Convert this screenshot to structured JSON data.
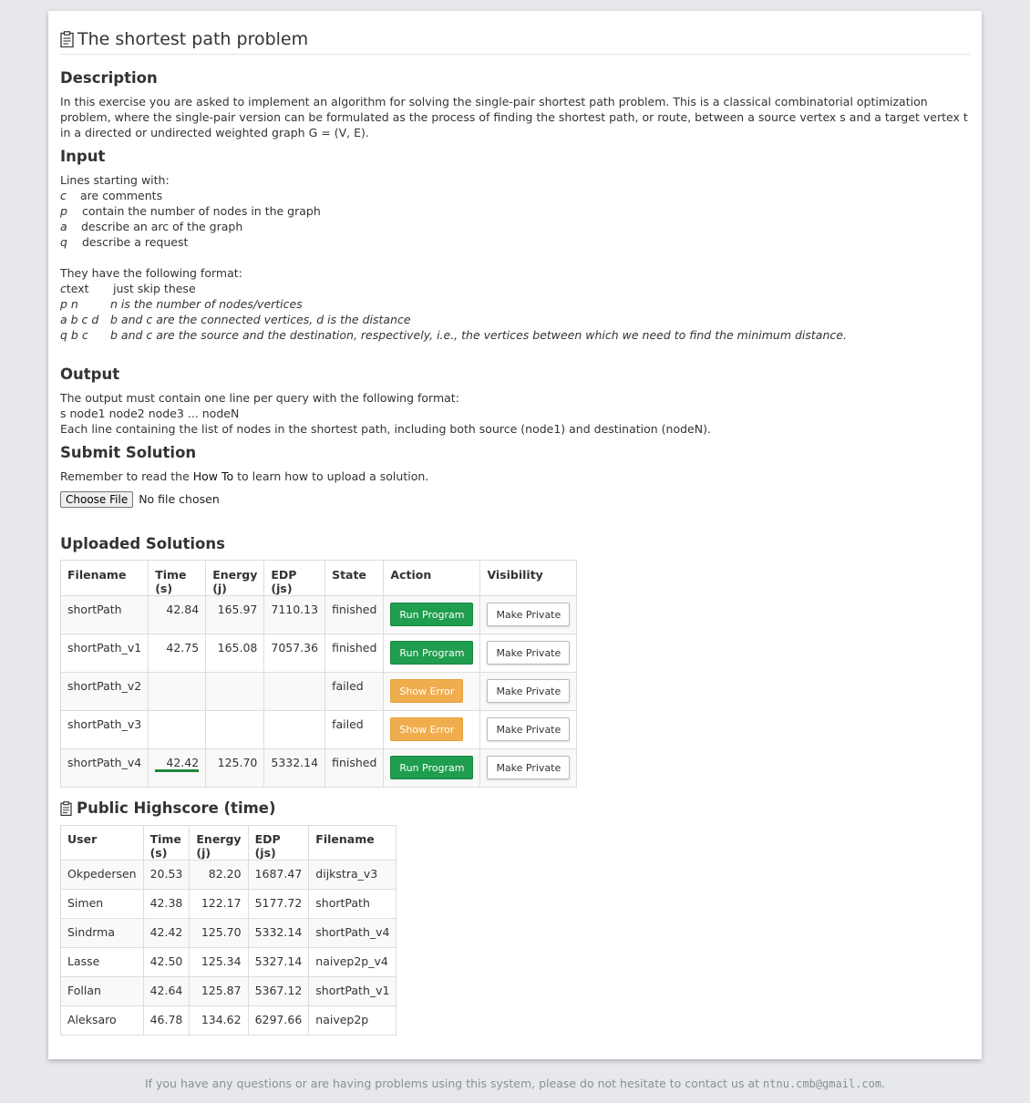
{
  "title": "The shortest path problem",
  "description": {
    "heading": "Description",
    "text": "In this exercise you are asked to implement an algorithm for solving the single-pair shortest path problem. This is a classical combinatorial optimization problem, where the single-pair version can be formulated as the process of finding the shortest path, or route, between a source vertex s and a target vertex t in a directed or undirected weighted graph G = (V, E)."
  },
  "input": {
    "heading": "Input",
    "intro": "Lines starting with:",
    "lines": [
      {
        "key": "c",
        "text": "are comments"
      },
      {
        "key": "p",
        "text": "contain the number of nodes in the graph"
      },
      {
        "key": "a",
        "text": "describe an arc of the graph"
      },
      {
        "key": "q",
        "text": "describe a request"
      }
    ],
    "format_intro": "They have the following format:",
    "formats": [
      {
        "key": "c",
        "key_rest": "text",
        "text": "just skip these"
      },
      {
        "key": "p n",
        "key_rest": "",
        "text": "n is the number of nodes/vertices"
      },
      {
        "key": "a b c d",
        "key_rest": "",
        "text": "b and c are the connected vertices, d is the distance"
      },
      {
        "key": "q b c",
        "key_rest": "",
        "text": "b and c are the source and the destination, respectively, i.e., the vertices between which we need to find the minimum distance."
      }
    ]
  },
  "output": {
    "heading": "Output",
    "line1": "The output must contain one line per query with the following format:",
    "line2": "s node1 node2 node3 ... nodeN",
    "line3": "Each line containing the list of nodes in the shortest path, including both source (node1) and destination (nodeN)."
  },
  "submit": {
    "heading": "Submit Solution",
    "text_before": "Remember to read the",
    "link": "How To",
    "text_after": "to learn how to upload a solution.",
    "file_button": "Choose File",
    "file_status": "No file chosen"
  },
  "uploaded": {
    "heading": "Uploaded Solutions",
    "columns": [
      "Filename",
      "Time (s)",
      "Energy (j)",
      "EDP (js)",
      "State",
      "Action",
      "Visibility"
    ],
    "rows": [
      {
        "filename": "shortPath",
        "time": "42.84",
        "energy": "165.97",
        "edp": "7110.13",
        "state": "finished",
        "action": "Run Program",
        "action_kind": "green",
        "visibility": "Make Private"
      },
      {
        "filename": "shortPath_v1",
        "time": "42.75",
        "energy": "165.08",
        "edp": "7057.36",
        "state": "finished",
        "action": "Run Program",
        "action_kind": "green",
        "visibility": "Make Private"
      },
      {
        "filename": "shortPath_v2",
        "time": "",
        "energy": "",
        "edp": "",
        "state": "failed",
        "action": "Show Error",
        "action_kind": "orange",
        "visibility": "Make Private"
      },
      {
        "filename": "shortPath_v3",
        "time": "",
        "energy": "",
        "edp": "",
        "state": "failed",
        "action": "Show Error",
        "action_kind": "orange",
        "visibility": "Make Private"
      },
      {
        "filename": "shortPath_v4",
        "time": "42.42",
        "energy": "125.70",
        "edp": "5332.14",
        "state": "finished",
        "action": "Run Program",
        "action_kind": "green",
        "visibility": "Make Private"
      }
    ]
  },
  "highscore": {
    "heading": "Public Highscore (time)",
    "columns": [
      "User",
      "Time (s)",
      "Energy (j)",
      "EDP (js)",
      "Filename"
    ],
    "rows": [
      {
        "user": "Okpedersen",
        "time": "20.53",
        "energy": "82.20",
        "edp": "1687.47",
        "filename": "dijkstra_v3"
      },
      {
        "user": "Simen",
        "time": "42.38",
        "energy": "122.17",
        "edp": "5177.72",
        "filename": "shortPath"
      },
      {
        "user": "Sindrma",
        "time": "42.42",
        "energy": "125.70",
        "edp": "5332.14",
        "filename": "shortPath_v4"
      },
      {
        "user": "Lasse",
        "time": "42.50",
        "energy": "125.34",
        "edp": "5327.14",
        "filename": "naivep2p_v4"
      },
      {
        "user": "Follan",
        "time": "42.64",
        "energy": "125.87",
        "edp": "5367.12",
        "filename": "shortPath_v1"
      },
      {
        "user": "Aleksaro",
        "time": "46.78",
        "energy": "134.62",
        "edp": "6297.66",
        "filename": "naivep2p"
      }
    ]
  },
  "footer": {
    "text": "If you have any questions or are having problems using this system, please do not hesitate to contact us at",
    "email": "ntnu.cmb@gmail.com",
    "end": "."
  },
  "colors": {
    "run_button": "#1e9e4e",
    "error_button": "#f0ad4e",
    "page_bg": "#e6e8ec"
  }
}
